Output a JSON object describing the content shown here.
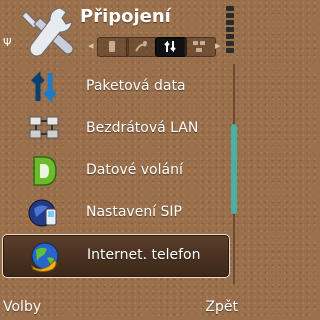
{
  "header": {
    "title": "Připojení",
    "tabs": [
      {
        "icon": "phone-icon",
        "active": false
      },
      {
        "icon": "link-icon",
        "active": false
      },
      {
        "icon": "data-arrows-icon",
        "active": true
      },
      {
        "icon": "network-icon",
        "active": false
      }
    ]
  },
  "list": {
    "items": [
      {
        "label": "Paketová data",
        "icon": "packet-data-icon",
        "selected": false
      },
      {
        "label": "Bezdrátová LAN",
        "icon": "wlan-icon",
        "selected": false
      },
      {
        "label": "Datové volání",
        "icon": "data-call-icon",
        "selected": false
      },
      {
        "label": "Nastavení SIP",
        "icon": "sip-settings-icon",
        "selected": false
      },
      {
        "label": "Internet. telefon",
        "icon": "internet-phone-icon",
        "selected": true
      }
    ]
  },
  "softkeys": {
    "left": "Volby",
    "right": "Zpět"
  },
  "colors": {
    "background": "#9a6f4b",
    "selection": "#3b2718",
    "scroll_thumb": "#48b0a6"
  }
}
